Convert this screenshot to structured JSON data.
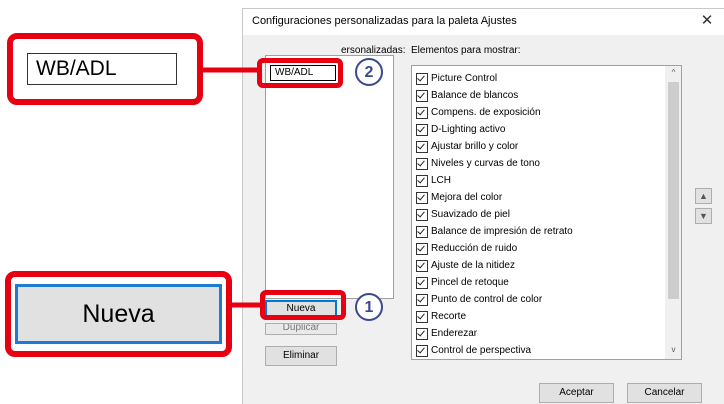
{
  "dialog": {
    "title": "Configuraciones personalizadas para la paleta Ajustes",
    "close_glyph": "✕",
    "custom_label": "ersonalizadas:",
    "custom_list_value": "WB/ADL",
    "items_label": "Elementos para mostrar:",
    "items": [
      "Picture Control",
      "Balance de blancos",
      "Compens. de exposición",
      "D-Lighting activo",
      "Ajustar brillo y color",
      "Niveles y curvas de tono",
      "LCH",
      "Mejora del color",
      "Suavizado de piel",
      "Balance de impresión de retrato",
      "Reducción de ruido",
      "Ajuste de la nitidez",
      "Pincel de retoque",
      "Punto de control de color",
      "Recorte",
      "Enderezar",
      "Control de perspectiva"
    ],
    "buttons": {
      "nueva": "Nueva",
      "duplicar": "Duplicar",
      "eliminar": "Eliminar",
      "aceptar": "Aceptar",
      "cancelar": "Cancelar",
      "move_up": "▲",
      "move_down": "▼"
    },
    "scroll": {
      "up": "^",
      "down": "v"
    }
  },
  "callouts": {
    "zoom_field_text": "WB/ADL",
    "zoom_button_text": "Nueva",
    "badge_1": "1",
    "badge_2": "2",
    "highlight_color": "#e60012",
    "badge_color": "#3a4a8c"
  }
}
